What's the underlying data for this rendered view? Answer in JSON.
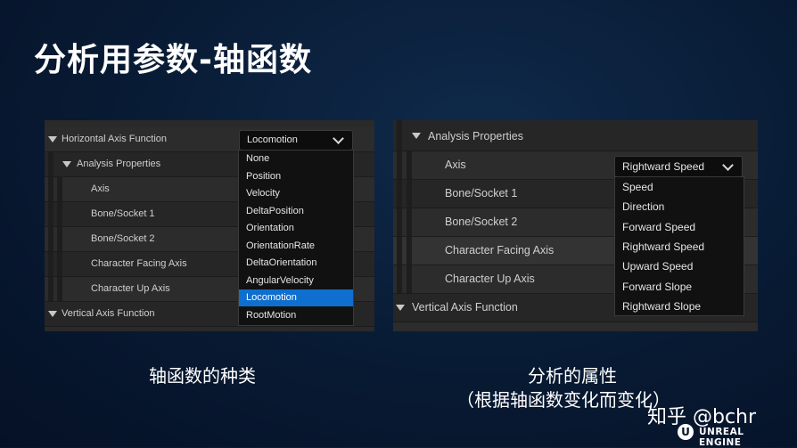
{
  "slide": {
    "title": "分析用参数-轴函数",
    "caption_left": "轴函数的种类",
    "caption_right_1": "分析的属性",
    "caption_right_2": "（根据轴函数变化而变化）"
  },
  "left_panel": {
    "rows": {
      "horizontal": "Horizontal Axis Function",
      "analysis": "Analysis Properties",
      "axis": "Axis",
      "bone1": "Bone/Socket 1",
      "bone2": "Bone/Socket 2",
      "facing": "Character Facing Axis",
      "up": "Character Up Axis",
      "vertical": "Vertical Axis Function"
    },
    "combo_value": "Locomotion",
    "options": [
      "None",
      "Position",
      "Velocity",
      "DeltaPosition",
      "Orientation",
      "OrientationRate",
      "DeltaOrientation",
      "AngularVelocity",
      "Locomotion",
      "RootMotion"
    ],
    "selected_option": "Locomotion"
  },
  "right_panel": {
    "rows": {
      "analysis": "Analysis Properties",
      "axis": "Axis",
      "bone1": "Bone/Socket 1",
      "bone2": "Bone/Socket 2",
      "facing": "Character Facing Axis",
      "up": "Character Up Axis",
      "vertical": "Vertical Axis Function"
    },
    "combo_value": "Rightward Speed",
    "options": [
      "Speed",
      "Direction",
      "Forward Speed",
      "Rightward Speed",
      "Upward Speed",
      "Forward Slope",
      "Rightward Slope"
    ]
  },
  "watermark": {
    "zhihu": "知乎 @bchr",
    "ue": "UNREAL ENGINE"
  }
}
